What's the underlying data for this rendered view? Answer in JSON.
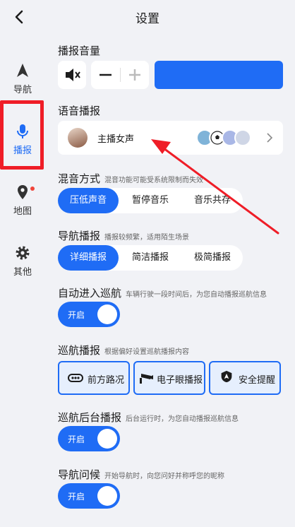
{
  "header": {
    "title": "设置"
  },
  "sidebar": {
    "items": [
      {
        "label": "导航",
        "icon": "navigation-arrow-icon"
      },
      {
        "label": "播报",
        "icon": "microphone-icon"
      },
      {
        "label": "地图",
        "icon": "map-pin-icon"
      },
      {
        "label": "其他",
        "icon": "gear-icon"
      }
    ],
    "active_index": 1,
    "highlight_color": "#ef1d27"
  },
  "volume": {
    "title": "播报音量",
    "level": 1.0
  },
  "voice": {
    "title": "语音播报",
    "current_voice": "主播女声"
  },
  "mix": {
    "title": "混音方式",
    "hint": "混音功能可能受系统限制而失效",
    "options": [
      "压低声音",
      "暂停音乐",
      "音乐共存"
    ],
    "selected": 0
  },
  "nav_broadcast": {
    "title": "导航播报",
    "hint": "播报较频繁，适用陌生场景",
    "options": [
      "详细播报",
      "简洁播报",
      "极简播报"
    ],
    "selected": 0
  },
  "auto_cruise": {
    "title": "自动进入巡航",
    "hint": "车辆行驶一段时间后，为您自动播报巡航信息",
    "toggle": "开启"
  },
  "cruise_broadcast": {
    "title": "巡航播报",
    "hint": "根据偏好设置巡航播报内容",
    "options": [
      "前方路况",
      "电子眼播报",
      "安全提醒"
    ]
  },
  "cruise_background": {
    "title": "巡航后台播报",
    "hint": "后台运行时，为您自动播报巡航信息",
    "toggle": "开启"
  },
  "nav_greeting": {
    "title": "导航问候",
    "hint": "开始导航时，向您问好并称呼您的昵称",
    "toggle": "开启"
  },
  "colors": {
    "accent": "#1f6cf5",
    "annotation": "#ef1d27"
  }
}
